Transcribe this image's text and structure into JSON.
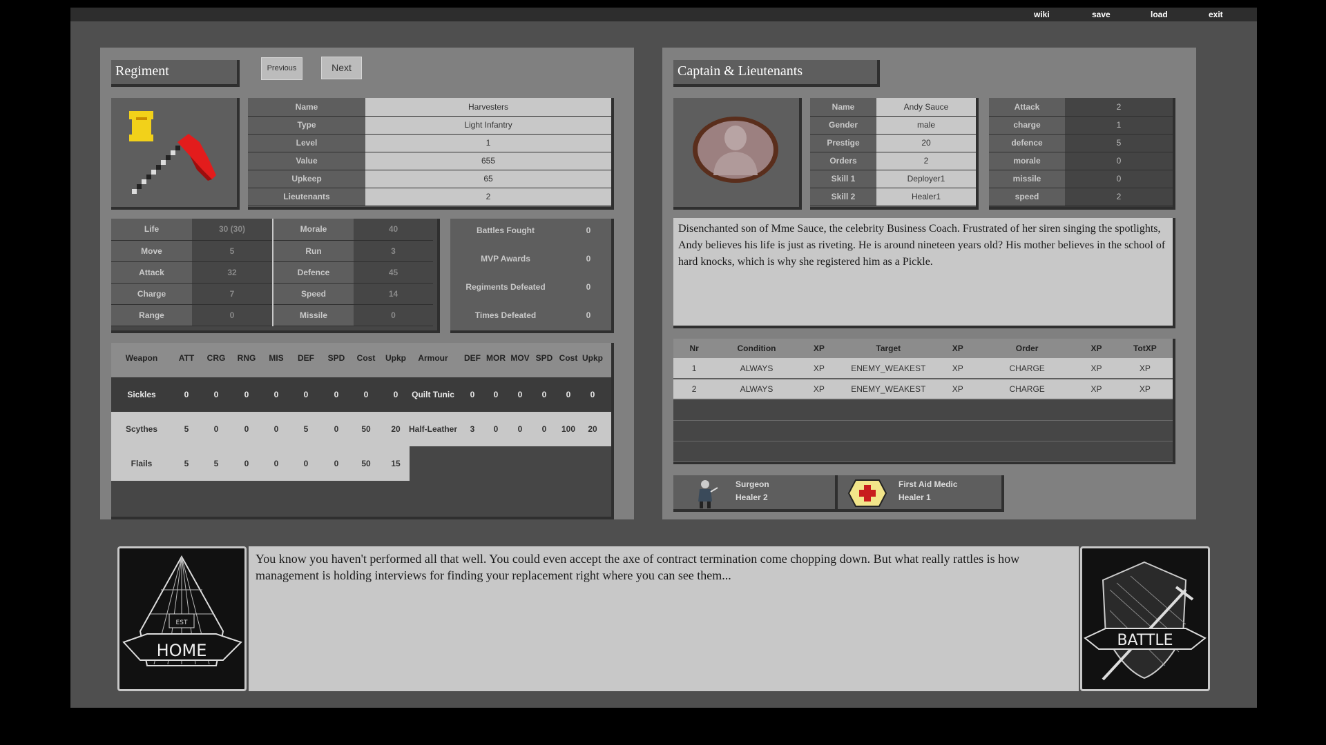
{
  "menu": {
    "wiki": "wiki",
    "save": "save",
    "load": "load",
    "exit": "exit"
  },
  "regiment": {
    "heading": "Regiment",
    "prev_label": "Previous",
    "next_label": "Next",
    "info": [
      {
        "label": "Name",
        "value": "Harvesters"
      },
      {
        "label": "Type",
        "value": "Light Infantry"
      },
      {
        "label": "Level",
        "value": "1"
      },
      {
        "label": "Value",
        "value": "655"
      },
      {
        "label": "Upkeep",
        "value": "65"
      },
      {
        "label": "Lieutenants",
        "value": "2"
      }
    ],
    "stats": [
      {
        "l1": "Life",
        "v1": "30 (30)",
        "l2": "Morale",
        "v2": "40"
      },
      {
        "l1": "Move",
        "v1": "5",
        "l2": "Run",
        "v2": "3"
      },
      {
        "l1": "Attack",
        "v1": "32",
        "l2": "Defence",
        "v2": "45"
      },
      {
        "l1": "Charge",
        "v1": "7",
        "l2": "Speed",
        "v2": "14"
      },
      {
        "l1": "Range",
        "v1": "0",
        "l2": "Missile",
        "v2": "0"
      }
    ],
    "record": [
      {
        "label": "Battles Fought",
        "value": "0"
      },
      {
        "label": "MVP Awards",
        "value": "0"
      },
      {
        "label": "Regiments Defeated",
        "value": "0"
      },
      {
        "label": "Times Defeated",
        "value": "0"
      }
    ],
    "weapon_headers": [
      "Weapon",
      "ATT",
      "CRG",
      "RNG",
      "MIS",
      "DEF",
      "SPD",
      "Cost",
      "Upkp"
    ],
    "armour_headers": [
      "Armour",
      "DEF",
      "MOR",
      "MOV",
      "SPD",
      "Cost",
      "Upkp"
    ],
    "weapons": [
      [
        "Sickles",
        "0",
        "0",
        "0",
        "0",
        "0",
        "0",
        "0",
        "0"
      ],
      [
        "Scythes",
        "5",
        "0",
        "0",
        "0",
        "5",
        "0",
        "50",
        "20"
      ],
      [
        "Flails",
        "5",
        "5",
        "0",
        "0",
        "0",
        "0",
        "50",
        "15"
      ]
    ],
    "armours": [
      [
        "Quilt Tunic",
        "0",
        "0",
        "0",
        "0",
        "0",
        "0"
      ],
      [
        "Half-Leather",
        "3",
        "0",
        "0",
        "0",
        "100",
        "20"
      ]
    ]
  },
  "captain": {
    "heading": "Captain & Lieutenants",
    "info": [
      {
        "label": "Name",
        "value": "Andy Sauce"
      },
      {
        "label": "Gender",
        "value": "male"
      },
      {
        "label": "Prestige",
        "value": "20"
      },
      {
        "label": "Orders",
        "value": "2"
      },
      {
        "label": "Skill 1",
        "value": "Deployer1"
      },
      {
        "label": "Skill 2",
        "value": "Healer1"
      }
    ],
    "stats": [
      {
        "label": "Attack",
        "value": "2"
      },
      {
        "label": "charge",
        "value": "1"
      },
      {
        "label": "defence",
        "value": "5"
      },
      {
        "label": "morale",
        "value": "0"
      },
      {
        "label": "missile",
        "value": "0"
      },
      {
        "label": "speed",
        "value": "2"
      }
    ],
    "bio": "Disenchanted son of Mme Sauce, the celebrity Business Coach. Frustrated of her siren singing the spotlights, Andy believes his life is just as riveting. He is around nineteen years old? His mother believes in the school of hard knocks, which is why she registered him as a Pickle.",
    "order_headers": [
      "Nr",
      "Condition",
      "XP",
      "Target",
      "XP",
      "Order",
      "XP",
      "TotXP"
    ],
    "orders": [
      [
        "1",
        "ALWAYS",
        "XP",
        "ENEMY_WEAKEST",
        "XP",
        "CHARGE",
        "XP",
        "XP"
      ],
      [
        "2",
        "ALWAYS",
        "XP",
        "ENEMY_WEAKEST",
        "XP",
        "CHARGE",
        "XP",
        "XP"
      ]
    ],
    "lieutenants": [
      {
        "name": "Surgeon",
        "skill": "Healer 2"
      },
      {
        "name": "First Aid Medic",
        "skill": "Healer 1"
      }
    ]
  },
  "footer": {
    "home_label": "HOME",
    "home_sign": "EST",
    "battle_label": "BATTLE",
    "message": "You know you haven't performed all that well. You could even accept the axe of contract termination come chopping down. But what really rattles is how management is holding interviews for finding your replacement right where you can see them..."
  }
}
